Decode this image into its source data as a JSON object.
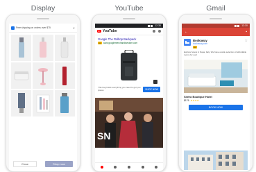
{
  "panels": {
    "display": "Display",
    "youtube": "YouTube",
    "gmail": "Gmail"
  },
  "display_ad": {
    "banner_text": "Free shipping on orders over $75",
    "close_label": "Close",
    "shop_label": "Shop now"
  },
  "youtube_ad": {
    "wordmark": "YouTube",
    "ad_title": "Google The Rolltop Backpack",
    "ad_badge": "Ad",
    "ad_url": "www.googlemerchandisestore.com",
    "description": "This bag holds everything you need to get you places",
    "cta_label": "SHOP NOW"
  },
  "gmail_ad": {
    "sender": "Bookaway",
    "sender_domain": "bookaway.com",
    "ad_badge": "Ad",
    "description": "Explore hotels in Napa, Italy. We have a wide selection of affordable rooms for you!",
    "listing_title": "Sintra Boutique Hotel",
    "price": "$176",
    "cta_label": "BOOK NOW"
  },
  "status_bar": {
    "time": "12:30"
  },
  "colors": {
    "youtube_red": "#ff0000",
    "gmail_red": "#db4437",
    "cta_blue": "#1a73e8",
    "ad_badge": "#fbbc04"
  },
  "icons": [
    "close-icon",
    "search-icon",
    "account-icon",
    "back-arrow-icon",
    "delete-icon",
    "star-icon",
    "home-icon",
    "play-icon"
  ]
}
